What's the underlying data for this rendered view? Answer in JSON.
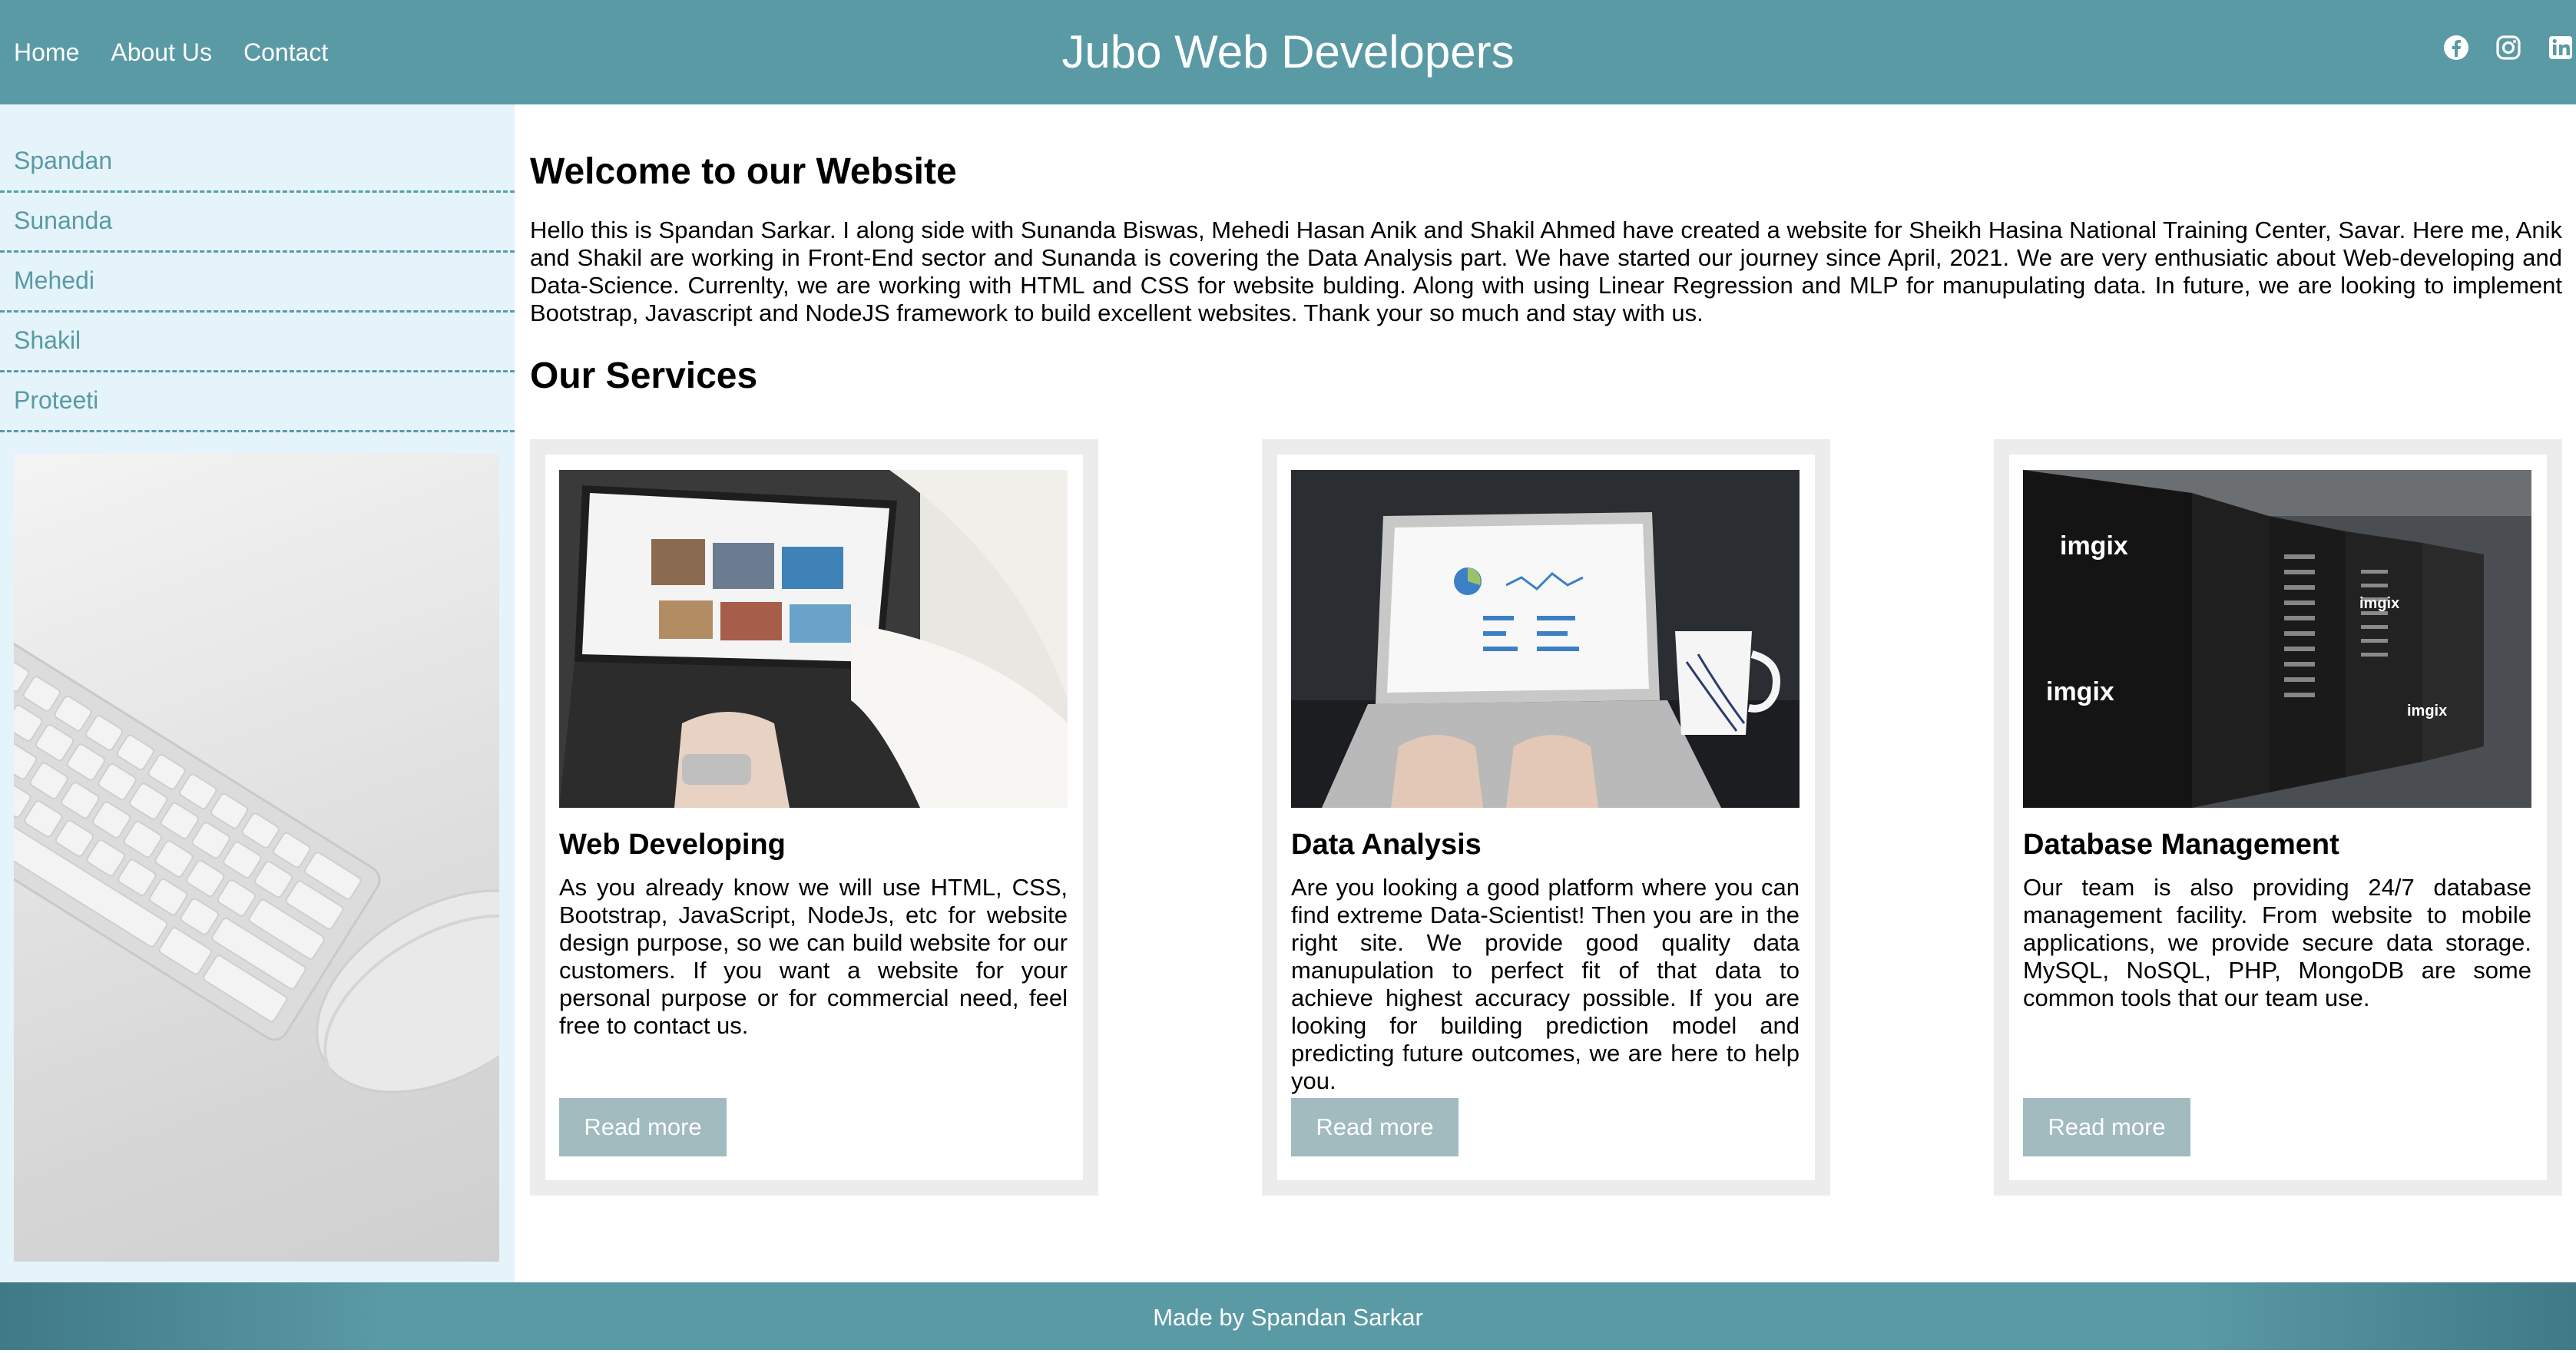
{
  "header": {
    "nav": [
      {
        "label": "Home"
      },
      {
        "label": "About Us"
      },
      {
        "label": "Contact"
      }
    ],
    "title": "Jubo Web Developers",
    "social_icons": [
      "facebook-icon",
      "instagram-icon",
      "linkedin-icon"
    ],
    "background_color": "#5a9aa5"
  },
  "sidebar": {
    "items": [
      {
        "label": "Spandan"
      },
      {
        "label": "Sunanda"
      },
      {
        "label": "Mehedi"
      },
      {
        "label": "Shakil"
      },
      {
        "label": "Proteeti"
      }
    ],
    "background_color": "#e4f4fa",
    "image": "keyboard-and-mouse-photo"
  },
  "main": {
    "welcome_heading": "Welcome to our Website",
    "intro": "Hello this is Spandan Sarkar. I along side with Sunanda Biswas, Mehedi Hasan Anik and Shakil Ahmed have created a website for Sheikh Hasina National Training Center, Savar. Here me, Anik and Shakil are working in Front-End sector and Sunanda is covering the Data Analysis part. We have started our journey since April, 2021. We are very enthusiatic about Web-developing and Data-Science. Currenlty, we are working with HTML and CSS for website bulding. Along with using Linear Regression and MLP for manupulating data. In future, we are looking to implement Bootstrap, Javascript and NodeJS framework to build excellent websites. Thank your so much and stay with us.",
    "services_heading": "Our Services",
    "services": [
      {
        "title": "Web Developing",
        "text": "As you already know we will use HTML, CSS, Bootstrap, JavaScript, NodeJs, etc for website design purpose, so we can build website for our customers. If you want a website for your personal purpose or for commercial need, feel free to contact us.",
        "button": "Read more",
        "image": "laptop-web-browsing-photo"
      },
      {
        "title": "Data Analysis",
        "text": "Are you looking a good platform where you can find extreme Data-Scientist! Then you are in the right site. We provide good quality data manupulation to perfect fit of that data to achieve highest accuracy possible. If you are looking for building prediction model and predicting future outcomes, we are here to help you.",
        "button": "Read more",
        "image": "laptop-dashboard-photo"
      },
      {
        "title": "Database Management",
        "text": "Our team is also providing 24/7 database management facility. From website to mobile applications, we provide secure data storage. MySQL, NoSQL, PHP, MongoDB are some common tools that our team use.",
        "button": "Read more",
        "image": "server-racks-photo",
        "image_brand": "imgix"
      }
    ],
    "button_color": "#a1bbbf"
  },
  "footer": {
    "text": "Made by Spandan Sarkar"
  }
}
